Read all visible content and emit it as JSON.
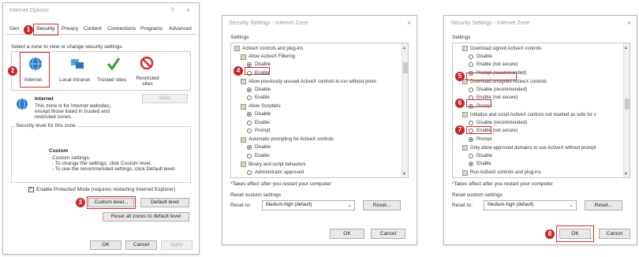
{
  "dialog1": {
    "title": "Internet Options",
    "help": "?",
    "close": "×",
    "tabs": [
      "Gen",
      "Security",
      "Privacy",
      "Content",
      "Connections",
      "Programs",
      "Advanced"
    ],
    "select_zone": "Select a zone to view or change security settings.",
    "zones": [
      "Internet",
      "Local intranet",
      "Trusted sites",
      "Restricted sites"
    ],
    "zone_title": "Internet",
    "zone_desc": [
      "This zone is for Internet websites,",
      "except those listed in trusted and",
      "restricted zones."
    ],
    "sites_button": "Sites",
    "security_level_label": "Security level for this zone",
    "custom_title": "Custom",
    "custom_lines": [
      "Custom settings.",
      "- To change the settings, click Custom level.",
      "- To use the recommended settings, click Default level."
    ],
    "protected_mode": "Enable Protected Mode (requires restarting Internet Explorer)",
    "custom_level_button": "Custom level...",
    "default_level_button": "Default level",
    "reset_all_button": "Reset all zones to default level",
    "ok": "OK",
    "cancel": "Cancel",
    "apply": "Apply"
  },
  "dialog2": {
    "title": "Security Settings - Internet Zone",
    "close": "×",
    "settings_label": "Settings",
    "rows": [
      {
        "kind": "cat",
        "text": "ActiveX controls and plug-ins"
      },
      {
        "kind": "sub",
        "text": "Allow ActiveX Filtering"
      },
      {
        "kind": "radio",
        "text": "Disable",
        "checked": true
      },
      {
        "kind": "radio",
        "text": "Enable",
        "checked": false
      },
      {
        "kind": "sub",
        "text": "Allow previously unused ActiveX controls to run without prom"
      },
      {
        "kind": "radio",
        "text": "Disable",
        "checked": true
      },
      {
        "kind": "radio",
        "text": "Enable",
        "checked": false
      },
      {
        "kind": "sub",
        "text": "Allow Scriptlets"
      },
      {
        "kind": "radio",
        "text": "Disable",
        "checked": true
      },
      {
        "kind": "radio",
        "text": "Enable",
        "checked": false
      },
      {
        "kind": "radio",
        "text": "Prompt",
        "checked": false
      },
      {
        "kind": "sub",
        "text": "Automatic prompting for ActiveX controls"
      },
      {
        "kind": "radio",
        "text": "Disable",
        "checked": true
      },
      {
        "kind": "radio",
        "text": "Enable",
        "checked": false
      },
      {
        "kind": "sub",
        "text": "Binary and script behaviors"
      },
      {
        "kind": "radio",
        "text": "Administrator approved",
        "checked": false
      }
    ],
    "takes_effect": "*Takes effect after you restart your computer",
    "reset_custom": "Reset custom settings",
    "reset_to": "Reset to:",
    "reset_value": "Medium-high (default)",
    "reset_button": "Reset...",
    "ok": "OK",
    "cancel": "Cancel"
  },
  "dialog3": {
    "title": "Security Settings - Internet Zone",
    "close": "×",
    "settings_label": "Settings",
    "rows": [
      {
        "kind": "sub",
        "text": "Download signed ActiveX controls"
      },
      {
        "kind": "radio",
        "text": "Disable",
        "checked": false
      },
      {
        "kind": "radio",
        "text": "Enable (not secure)",
        "checked": false
      },
      {
        "kind": "radio",
        "text": "Prompt (recommended)",
        "checked": true
      },
      {
        "kind": "sub",
        "text": "Download unsigned ActiveX controls"
      },
      {
        "kind": "radio",
        "text": "Disable (recommended)",
        "checked": false
      },
      {
        "kind": "radio",
        "text": "Enable (not secure)",
        "checked": false
      },
      {
        "kind": "radio",
        "text": "Prompt",
        "checked": true
      },
      {
        "kind": "sub",
        "text": "Initialize and script ActiveX controls not marked as safe for s"
      },
      {
        "kind": "radio",
        "text": "Disable (recommended)",
        "checked": false
      },
      {
        "kind": "radio",
        "text": "Enable (not secure)",
        "checked": false
      },
      {
        "kind": "radio",
        "text": "Prompt",
        "checked": true
      },
      {
        "kind": "sub",
        "text": "Only allow approved domains to use ActiveX without prompt"
      },
      {
        "kind": "radio",
        "text": "Disable",
        "checked": false
      },
      {
        "kind": "radio",
        "text": "Enable",
        "checked": true
      },
      {
        "kind": "sub",
        "text": "Run ActiveX controls and plug-ins"
      }
    ],
    "takes_effect": "*Takes effect after you restart your computer",
    "reset_custom": "Reset custom settings",
    "reset_to": "Reset to:",
    "reset_value": "Medium-high (default)",
    "reset_button": "Reset...",
    "ok": "OK",
    "cancel": "Cancel"
  },
  "badges": [
    "1",
    "2",
    "3",
    "4",
    "5",
    "6",
    "7",
    "8"
  ],
  "colors": {
    "badge": "#c62828",
    "highlight": "#d32f2f"
  },
  "icons": {
    "globe": "globe-icon",
    "intranet": "computers-icon",
    "trusted": "check-icon",
    "restricted": "no-entry-icon",
    "shield": "shield-icon"
  }
}
